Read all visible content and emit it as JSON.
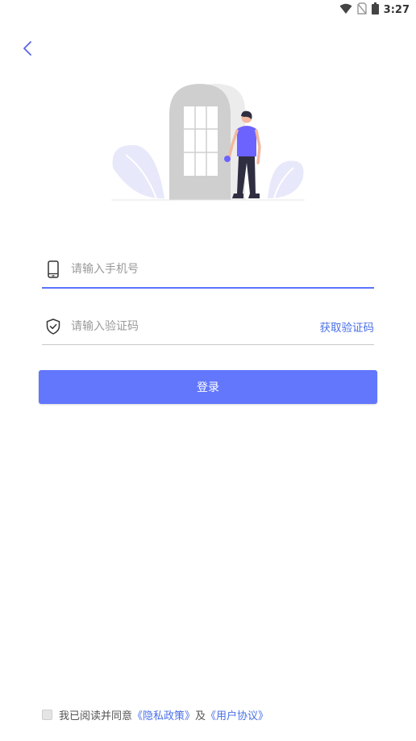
{
  "status_bar": {
    "time": "3:27",
    "icons": [
      "wifi-icon",
      "no-sim-icon",
      "battery-icon"
    ]
  },
  "nav": {
    "back_icon": "chevron-left-icon"
  },
  "form": {
    "phone": {
      "placeholder": "请输入手机号",
      "icon": "phone-icon",
      "value": ""
    },
    "code": {
      "placeholder": "请输入验证码",
      "icon": "shield-check-icon",
      "value": "",
      "get_code_label": "获取验证码"
    },
    "login_label": "登录"
  },
  "agreement": {
    "prefix": "我已阅读并同意",
    "privacy_link": "《隐私政策》",
    "conjunction": "及",
    "terms_link": "《用户协议》"
  },
  "colors": {
    "accent": "#6277fc",
    "link": "#4a6fe6",
    "back_arrow": "#5b63e6"
  }
}
